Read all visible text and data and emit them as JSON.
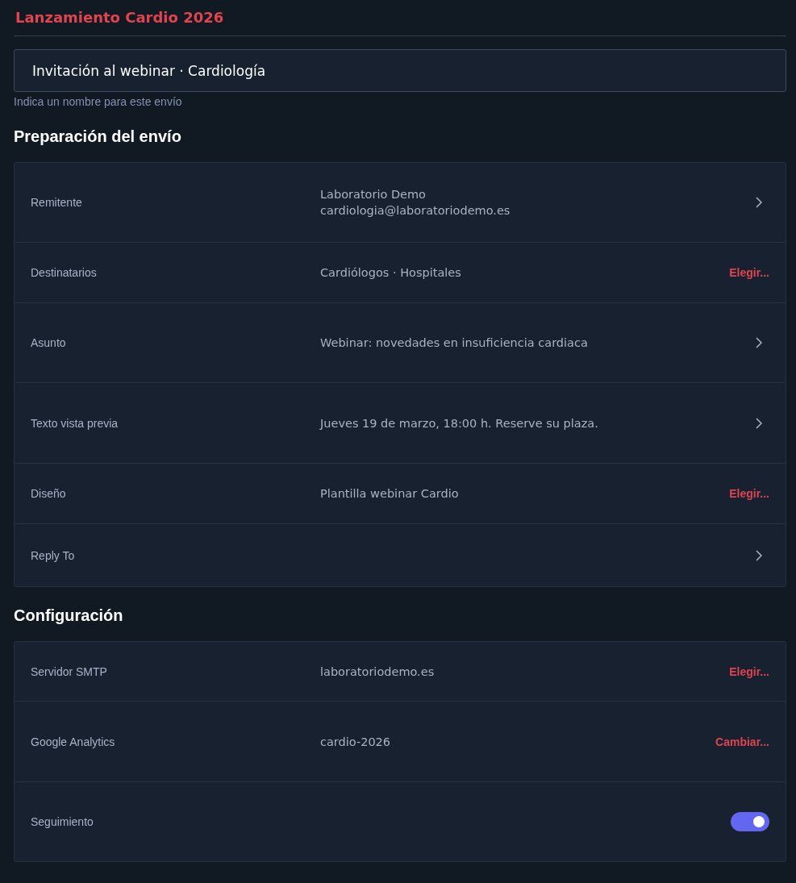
{
  "title": "Lanzamiento Cardio 2026",
  "name_field": {
    "value": "Invitación al webinar · Cardiología",
    "hint": "Indica un nombre para este envío"
  },
  "sections": [
    {
      "heading": "Preparación del envío",
      "rows": [
        {
          "label": "Remitente",
          "values": [
            "Laboratorio Demo",
            "cardiologia@laboratoriodemo.es"
          ],
          "kind": "chevron"
        },
        {
          "label": "Destinatarios",
          "values": [
            "Cardiólogos · Hospitales"
          ],
          "kind": "link",
          "action": "Elegir..."
        },
        {
          "label": "Asunto",
          "values": [
            "Webinar: novedades en insuficiencia cardiaca"
          ],
          "kind": "chevron"
        },
        {
          "label": "Texto vista previa",
          "values": [
            "Jueves 19 de marzo, 18:00 h. Reserve su plaza."
          ],
          "kind": "chevron"
        },
        {
          "label": "Diseño",
          "values": [
            "Plantilla webinar Cardio"
          ],
          "kind": "link",
          "action": "Elegir..."
        },
        {
          "label": "Reply To",
          "values": [],
          "kind": "chevron"
        }
      ]
    },
    {
      "heading": "Configuración",
      "rows": [
        {
          "label": "Servidor SMTP",
          "values": [
            "laboratoriodemo.es"
          ],
          "kind": "link",
          "action": "Elegir..."
        },
        {
          "label": "Google Analytics",
          "values": [
            "cardio-2026"
          ],
          "kind": "link",
          "action": "Cambiar..."
        },
        {
          "label": "Seguimiento",
          "values": [],
          "kind": "toggle",
          "on": true
        }
      ]
    }
  ]
}
